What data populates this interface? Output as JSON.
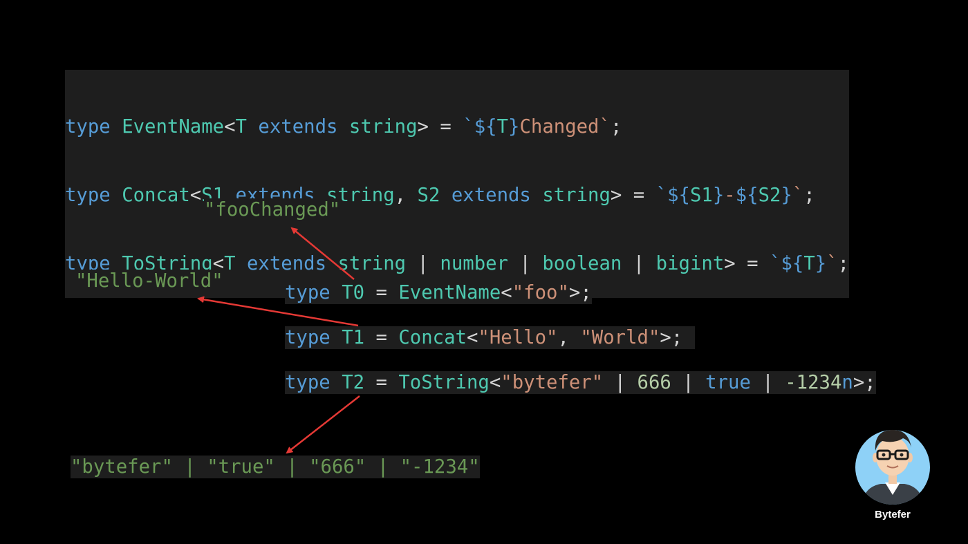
{
  "definitions": {
    "line1": {
      "kw": "type",
      "name": "EventName",
      "lt": "<",
      "tparam": "T",
      "ext": "extends",
      "constraint": "string",
      "tail": "> = ",
      "tpl_open": "`${",
      "tpl_var": "T",
      "tpl_close": "}",
      "literal": "Changed",
      "tick": "`",
      "end": ";"
    },
    "line2": {
      "kw": "type",
      "name": "Concat",
      "lt": "<",
      "tparam1": "S1",
      "ext1": "extends",
      "constraint1": "string",
      "comma": ", ",
      "tparam2": "S2",
      "ext2": "extends",
      "constraint2": "string",
      "tail": "> = ",
      "tpl_open1": "`${",
      "tpl_var1": "S1",
      "tpl_close1": "}",
      "dash": "-",
      "tpl_open2": "${",
      "tpl_var2": "S2",
      "tpl_close2": "}",
      "tick": "`",
      "end": ";"
    },
    "line3": {
      "kw": "type",
      "name": "ToString",
      "lt": "<",
      "tparam": "T",
      "ext": "extends",
      "c1": "string",
      "bar1": " | ",
      "c2": "number",
      "bar2": " | ",
      "c3": "boolean",
      "bar3": " | ",
      "c4": "bigint",
      "tail": "> = ",
      "tpl_open": "`${",
      "tpl_var": "T",
      "tpl_close": "}",
      "tick": "`",
      "end": ";"
    }
  },
  "usages": {
    "t0": {
      "kw": "type",
      "name": "T0",
      "eq": " = ",
      "generic": "EventName",
      "lt": "<",
      "arg": "\"foo\"",
      "end": ">;"
    },
    "t1": {
      "kw": "type",
      "name": "T1",
      "eq": " = ",
      "generic": "Concat",
      "lt": "<",
      "arg1": "\"Hello\"",
      "comma": ", ",
      "arg2": "\"World\"",
      "end": ">;"
    },
    "t2": {
      "kw": "type",
      "name": "T2",
      "eq": " = ",
      "generic": "ToString",
      "lt": "<",
      "arg1": "\"bytefer\"",
      "bar1": " | ",
      "arg2": "666",
      "bar2": " | ",
      "arg3": "true",
      "bar3": " | ",
      "arg4": "-1234",
      "suffix": "n",
      "end": ">;"
    }
  },
  "results": {
    "foo": "\"fooChanged\"",
    "hello": "\"Hello-World\"",
    "t2": "\"bytefer\" | \"true\" | \"666\" | \"-1234\""
  },
  "brand": {
    "name": "Bytefer"
  },
  "colors": {
    "background": "#000000",
    "code_bg": "#1e1e1e",
    "keyword": "#569cd6",
    "type_name": "#4ec9b0",
    "type_param": "#9cdcfe",
    "string": "#ce9178",
    "number": "#b5cea8",
    "result": "#6a9955",
    "arrow": "#e53935"
  }
}
